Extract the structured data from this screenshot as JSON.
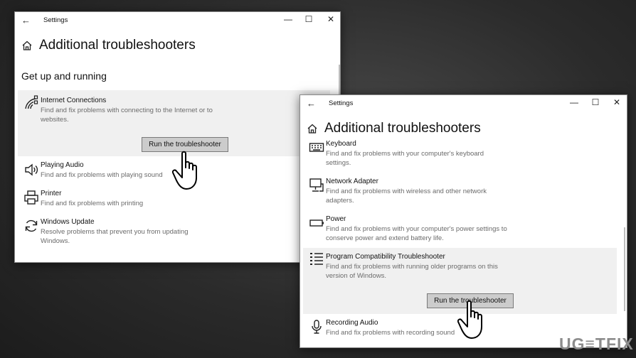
{
  "window1": {
    "title": "Settings",
    "heading": "Additional troubleshooters",
    "section": "Get up and running",
    "items": [
      {
        "name": "Internet Connections",
        "desc": "Find and fix problems with connecting to the Internet or to websites.",
        "icon": "wifi-icon"
      },
      {
        "name": "Playing Audio",
        "desc": "Find and fix problems with playing sound",
        "icon": "speaker-icon"
      },
      {
        "name": "Printer",
        "desc": "Find and fix problems with printing",
        "icon": "printer-icon"
      },
      {
        "name": "Windows Update",
        "desc": "Resolve problems that prevent you from updating Windows.",
        "icon": "refresh-icon"
      }
    ],
    "button": "Run the troubleshooter"
  },
  "window2": {
    "title": "Settings",
    "heading": "Additional troubleshooters",
    "items": [
      {
        "name": "Keyboard",
        "desc": "Find and fix problems with your computer's keyboard settings.",
        "icon": "keyboard-icon"
      },
      {
        "name": "Network Adapter",
        "desc": "Find and fix problems with wireless and other network adapters.",
        "icon": "monitor-network-icon"
      },
      {
        "name": "Power",
        "desc": "Find and fix problems with your computer's power settings to conserve power and extend battery life.",
        "icon": "battery-icon"
      },
      {
        "name": "Program Compatibility Troubleshooter",
        "desc": "Find and fix problems with running older programs on this version of Windows.",
        "icon": "list-icon"
      },
      {
        "name": "Recording Audio",
        "desc": "Find and fix problems with recording sound",
        "icon": "microphone-icon"
      }
    ],
    "button": "Run the troubleshooter"
  },
  "glyphs": {
    "back": "←",
    "minimize": "—",
    "maximize": "☐",
    "close": "✕"
  },
  "logo": "UG≡TFIX"
}
